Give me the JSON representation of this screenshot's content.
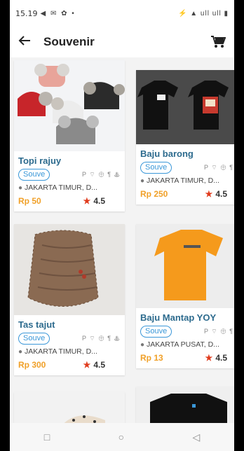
{
  "status_bar": {
    "time": "15.19",
    "left_icons": "◀ ✉ ✿ •",
    "right_icons": "⚡ ▲ ull ull ▮"
  },
  "app_bar": {
    "title": "Souvenir",
    "back_icon": "arrow-left-icon",
    "cart_icon": "cart-icon"
  },
  "products": [
    {
      "name": "Topi rajuy",
      "badge": "Souve",
      "amenities": "P ⌔ ⊕ ¶ ♨",
      "location": "JAKARTA TIMUR, D...",
      "price": "Rp 50",
      "rating": "4.5"
    },
    {
      "name": "Baju barong",
      "badge": "Souve",
      "amenities": "P ⌔ ⊕ ¶ ♨",
      "location": "JAKARTA TIMUR, D...",
      "price": "Rp 250",
      "rating": "4.5"
    },
    {
      "name": "Tas tajut",
      "badge": "Souve",
      "amenities": "P ⌔ ⊕ ¶ ♨",
      "location": "JAKARTA TIMUR, D...",
      "price": "Rp 300",
      "rating": "4.5"
    },
    {
      "name": "Baju Mantap YOY",
      "badge": "Souve",
      "amenities": "P ⌔ ⊕ ¶ ♨",
      "location": "JAKARTA PUSAT, D...",
      "price": "Rp 13",
      "rating": "4.5"
    }
  ],
  "nav_bar": {
    "recents": "□",
    "home": "○",
    "back": "◁"
  },
  "colors": {
    "accent": "#3a97d8",
    "name": "#2d6b8e",
    "price": "#f0a028",
    "star": "#e03c1e"
  }
}
